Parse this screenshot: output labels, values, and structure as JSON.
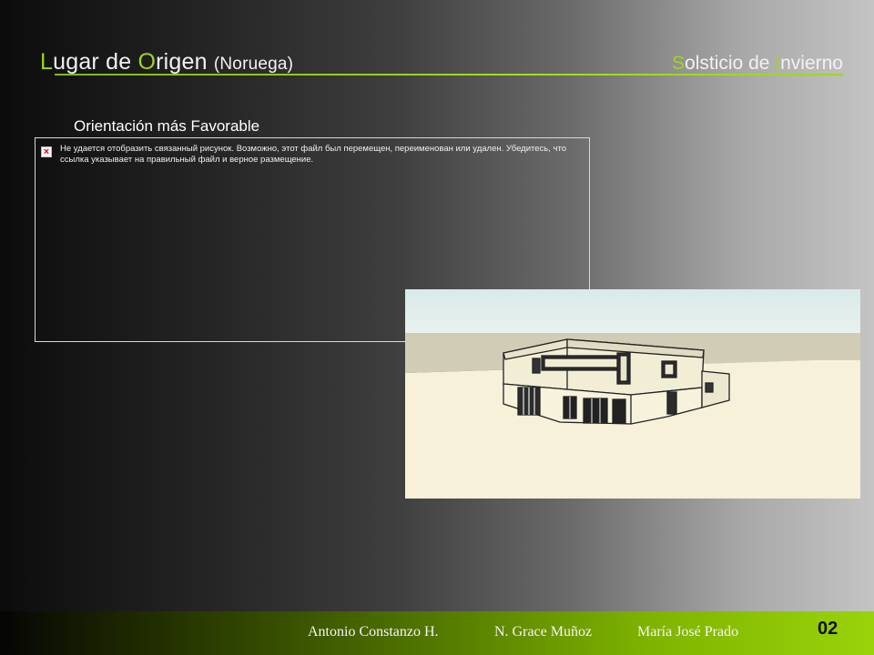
{
  "header": {
    "title_part1_initial": "L",
    "title_part1_rest": "ugar de ",
    "title_part2_initial": "O",
    "title_part2_rest": "rigen",
    "title_suffix": "(Noruega)",
    "right_part1_initial": "S",
    "right_part1_rest": "olsticio de ",
    "right_part2_initial": "I",
    "right_part2_rest": "nvierno"
  },
  "section": {
    "heading": "Orientación más Favorable"
  },
  "broken_image": {
    "message": "Не удается отобразить связанный рисунок. Возможно, этот файл был перемещен, переименован или удален. Убедитесь, что ссылка указывает на правильный файл и верное размещение.",
    "icon": "broken-image-icon"
  },
  "render_image": {
    "description_icon": "house-render-image"
  },
  "footer": {
    "authors": [
      "Antonio Constanzo H.",
      "N. Grace Muñoz",
      "María José Prado"
    ],
    "page_number": "02"
  },
  "colors": {
    "accent": "#9fd51e",
    "footer_end": "#99d30a"
  }
}
